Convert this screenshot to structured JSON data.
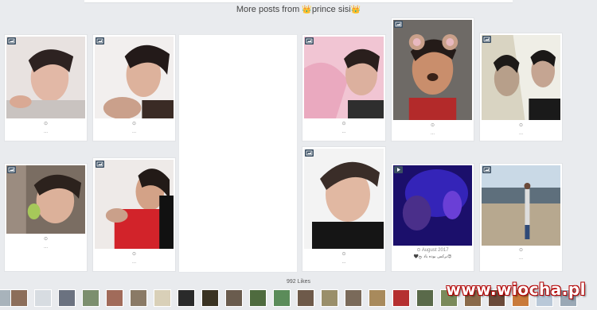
{
  "header": {
    "more_posts_prefix": "More posts from ",
    "crown_left": "👑",
    "author": "prince sisi",
    "crown_right": "👑"
  },
  "posts": [
    {
      "meta": "⊙",
      "dots": "...",
      "caption": ""
    },
    {
      "meta": "⊙",
      "dots": "...",
      "caption": ""
    },
    {
      "meta": "⊙",
      "dots": "...",
      "caption": ""
    },
    {
      "meta": "⊙",
      "dots": "...",
      "caption": ""
    },
    {
      "meta": "⊙",
      "dots": "...",
      "caption": ""
    },
    {
      "meta": "⊙",
      "dots": "...",
      "caption": ""
    },
    {
      "meta": "⊙",
      "dots": "...",
      "caption": ""
    },
    {
      "meta": "⊙",
      "dots": "...",
      "caption": ""
    },
    {
      "meta": "⊙ August 2017",
      "dots": "",
      "caption": "🖤برکس بوده یاد بخ😍"
    },
    {
      "meta": "⊙",
      "dots": "...",
      "caption": ""
    }
  ],
  "likes": "992 Likes",
  "watermark": "www.wiocha.pl",
  "colors": {
    "background": "#e9ebee",
    "card": "#ffffff",
    "badge": "#3b4f63",
    "watermark_outline": "#b30000"
  }
}
